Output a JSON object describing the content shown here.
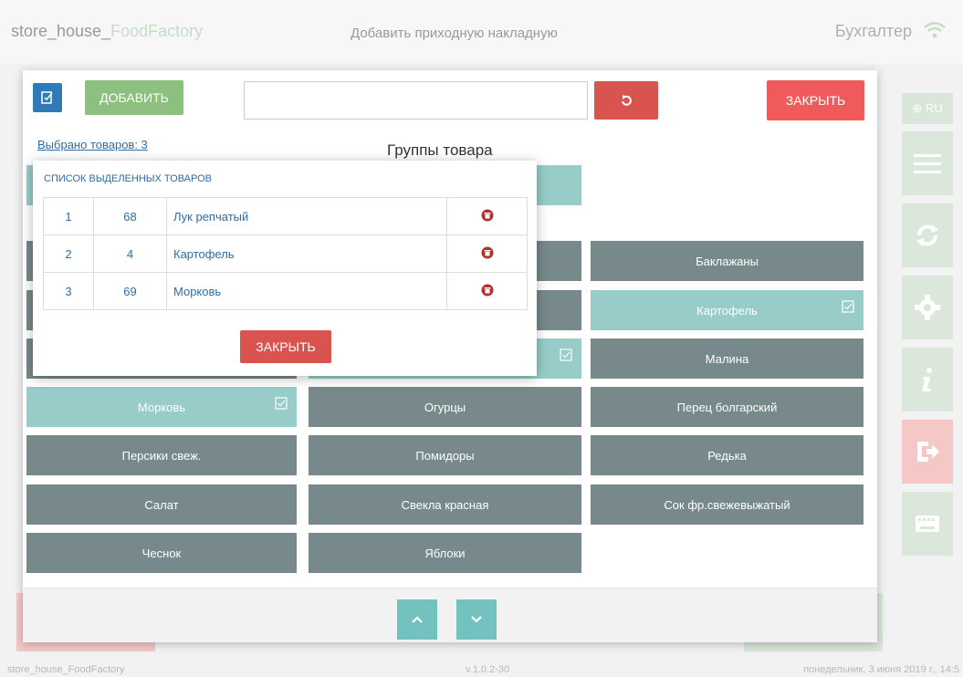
{
  "header": {
    "app_name_main": "store_house_",
    "app_name_accent": "FoodFactory",
    "page_title": "Добавить приходную накладную",
    "role": "Бухгалтер"
  },
  "rightbar": {
    "lang": "⊕ RU"
  },
  "footer": {
    "left": "store_house_FoodFactory",
    "version": "v.1.0.2-30",
    "datetime": "понедельник, 3 июня 2019 г., 14:5"
  },
  "toolbar": {
    "add_label": "ДОБАВИТЬ",
    "search_value": "",
    "close_label": "ЗАКРЫТЬ"
  },
  "selected_link": "Выбрано товаров: 3",
  "groups_title": "Группы товара",
  "products": [
    {
      "label": "Баклажаны",
      "selected": false
    },
    {
      "label": "Картофель",
      "selected": true
    },
    {
      "label": "Малина",
      "selected": false
    },
    {
      "label": "Морковь",
      "selected": true
    },
    {
      "label": "Огурцы",
      "selected": false
    },
    {
      "label": "Перец болгарский",
      "selected": false
    },
    {
      "label": "Персики свеж.",
      "selected": false
    },
    {
      "label": "Помидоры",
      "selected": false
    },
    {
      "label": "Редька",
      "selected": false
    },
    {
      "label": "Салат",
      "selected": false
    },
    {
      "label": "Свекла красная",
      "selected": false
    },
    {
      "label": "Сок фр.свежевыжатый",
      "selected": false
    },
    {
      "label": "Чеснок",
      "selected": false
    },
    {
      "label": "Яблоки",
      "selected": false
    }
  ],
  "popup": {
    "title": "СПИСОК ВЫДЕЛЕННЫХ ТОВАРОВ",
    "rows": [
      {
        "num": "1",
        "id": "68",
        "name": "Лук репчатый"
      },
      {
        "num": "2",
        "id": "4",
        "name": "Картофель"
      },
      {
        "num": "3",
        "id": "69",
        "name": "Морковь"
      }
    ],
    "close_label": "ЗАКРЫТЬ"
  },
  "colors": {
    "tile": "#77898a",
    "tile_selected": "#97ccc9",
    "danger": "#d9534f",
    "primary": "#2f7ab8",
    "success": "#8cc07e"
  }
}
